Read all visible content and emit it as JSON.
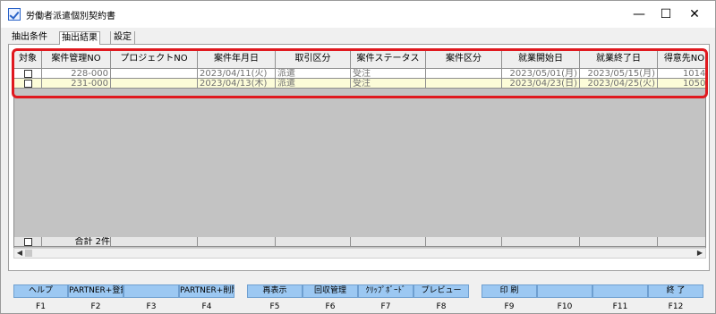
{
  "window": {
    "title": "労働者派遣個別契約書"
  },
  "window_controls": {
    "minimize": "—",
    "maximize": "☐",
    "close": "✕"
  },
  "tabs": [
    {
      "label": "抽出条件"
    },
    {
      "label": "抽出結果"
    },
    {
      "label": "設定"
    }
  ],
  "grid": {
    "columns": [
      "対象",
      "案件管理NO",
      "プロジェクトNO",
      "案件年月日",
      "取引区分",
      "案件ステータス",
      "案件区分",
      "就業開始日",
      "就業終了日",
      "得意先NO"
    ],
    "rows": [
      {
        "checked": false,
        "case_no": "228-000",
        "project_no": "",
        "date": "2023/04/11(火)",
        "trade": "派遣",
        "status": "受注",
        "kind": "",
        "start": "2023/05/01(月)",
        "end": "2023/05/15(月)",
        "customer": "1014-"
      },
      {
        "checked": false,
        "case_no": "231-000",
        "project_no": "",
        "date": "2023/04/13(木)",
        "trade": "派遣",
        "status": "受注",
        "kind": "",
        "start": "2023/04/23(日)",
        "end": "2023/04/25(火)",
        "customer": "1050-"
      }
    ],
    "footer": {
      "total_label": "合計 2件"
    }
  },
  "function_keys": [
    {
      "label": "ヘルプ",
      "key": "F1"
    },
    {
      "label": "PARTNER+登録",
      "key": "F2"
    },
    {
      "label": "",
      "key": "F3"
    },
    {
      "label": "PARTNER+削除",
      "key": "F4"
    },
    {
      "label": "再表示",
      "key": "F5"
    },
    {
      "label": "回収管理",
      "key": "F6"
    },
    {
      "label": "ｸﾘｯﾌﾟﾎﾞｰﾄﾞ",
      "key": "F7"
    },
    {
      "label": "プレビュー",
      "key": "F8"
    },
    {
      "label": "印 刷",
      "key": "F9"
    },
    {
      "label": "",
      "key": "F10"
    },
    {
      "label": "",
      "key": "F11"
    },
    {
      "label": "終 了",
      "key": "F12"
    }
  ],
  "colors": {
    "highlight": "#e0191f",
    "fkey": "#9cc8f2",
    "row_alt": "#fcfcd8"
  }
}
